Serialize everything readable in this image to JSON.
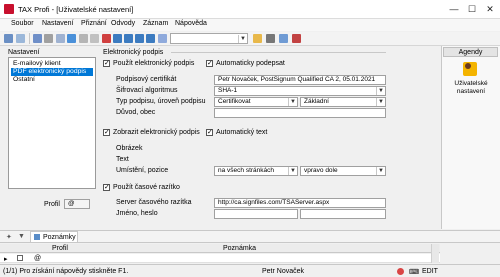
{
  "window": {
    "title": "TAX Profi - [Uživatelské nastavení]",
    "minimize_icon": "minimize-icon",
    "maximize_icon": "maximize-icon",
    "close_icon": "close-icon"
  },
  "menu": [
    "Soubor",
    "Nastavení",
    "Přiznání",
    "Odvody",
    "Záznam",
    "Nápověda"
  ],
  "settings_panel": {
    "header": "Nastavení",
    "items": [
      "E-mailový klient",
      "PDF elektronický podpis",
      "Ostatní"
    ],
    "selected_index": 1
  },
  "profile": {
    "label": "Profil",
    "value": "@"
  },
  "esign": {
    "section_title": "Elektronický podpis",
    "use_esign": {
      "label": "Použít elektronický podpis",
      "checked": true
    },
    "auto_sign": {
      "label": "Automaticky podepsat",
      "checked": true
    },
    "certificate_label": "Podpisový certifikát",
    "certificate_value": "Petr Novaček, PostSignum Qualified CA 2, 05.01.2021",
    "algorithm_label": "Šifrovací algoritmus",
    "algorithm_value": "SHA-1",
    "type_label": "Typ podpisu, úroveň podpisu",
    "type_value": "Certifikovat",
    "level_value": "Základní",
    "reason_label": "Důvod, obec",
    "reason_value": "",
    "show_esign": {
      "label": "Zobrazit elektronický podpis",
      "checked": true
    },
    "auto_text": {
      "label": "Automatický text",
      "checked": true
    },
    "image_label": "Obrázek",
    "text_label": "Text",
    "placement_label": "Umístění, pozice",
    "placement_value": "na všech stránkách",
    "position_value": "vpravo dole",
    "timestamp": {
      "label": "Použít časové razítko",
      "checked": true
    },
    "ts_server_label": "Server časového razítka",
    "ts_server_value": "http://ca.signfiles.com/TSAServer.aspx",
    "name_password_label": "Jméno, heslo",
    "name_password_value": ""
  },
  "agenda": {
    "header": "Agendy",
    "item_label": "Uživatelské nastavení"
  },
  "notes": {
    "tab_label": "Poznámky",
    "col_profile": "Profil",
    "col_note": "Poznámka",
    "row_profile": "@",
    "row_note": ""
  },
  "status": {
    "help": "(1/1) Pro získání nápovědy stiskněte F1.",
    "user": "Petr Novaček",
    "mode": "EDIT"
  },
  "colors": {
    "accent": "#0078d7",
    "app_icon": "#c8102e",
    "agenda_icon": "#f4b400"
  }
}
